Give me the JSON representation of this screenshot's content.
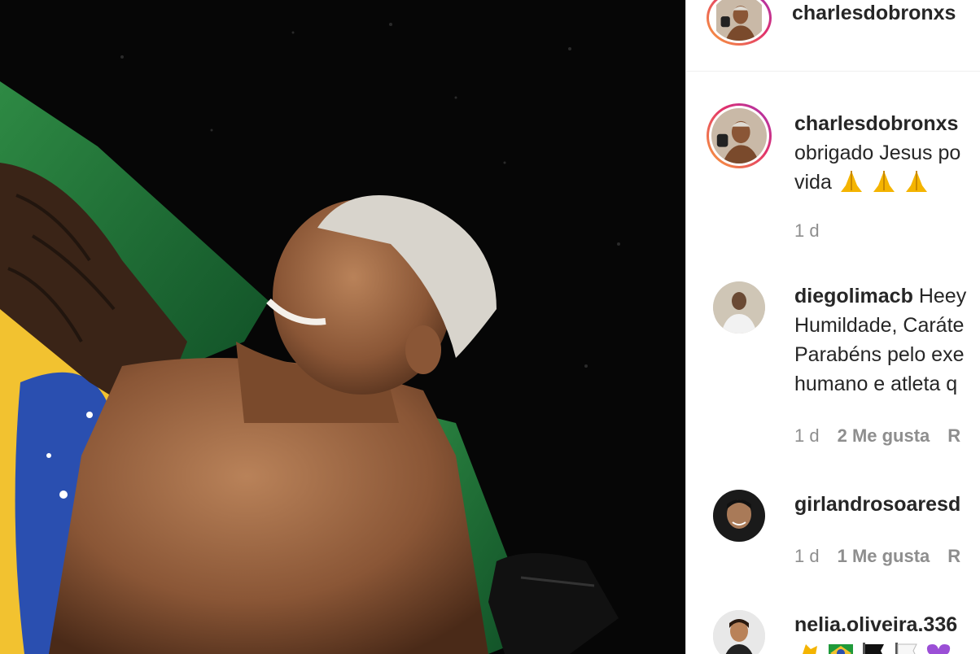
{
  "post": {
    "author": "charlesdobronxs"
  },
  "caption": {
    "username": "charlesdobronxs",
    "line1": "obrigado Jesus po",
    "line2": "vida",
    "emojis": [
      "folded-hands",
      "folded-hands",
      "folded-hands"
    ],
    "time": "1 d"
  },
  "comments": [
    {
      "username": "diegolimacb",
      "line1_rest": "Heey",
      "line2": "Humildade, Caráte",
      "line3": "Parabéns pelo exe",
      "line4": "humano e atleta q",
      "time": "1 d",
      "likes": "2 Me gusta",
      "reply": "R"
    },
    {
      "username": "girlandrosoaresd",
      "time": "1 d",
      "likes": "1 Me gusta",
      "reply": "R"
    },
    {
      "username": "nelia.oliveira.336",
      "emojis": [
        "clapping-hands",
        "brazil-flag",
        "black-flag",
        "white-flag",
        "purple-heart"
      ]
    }
  ],
  "colors": {
    "text": "#262626",
    "muted": "#8e8e8e",
    "border": "#dbdbdb",
    "flag_green": "#1f7a3a",
    "flag_yellow": "#f2c230",
    "flag_blue": "#2a4fb0"
  }
}
